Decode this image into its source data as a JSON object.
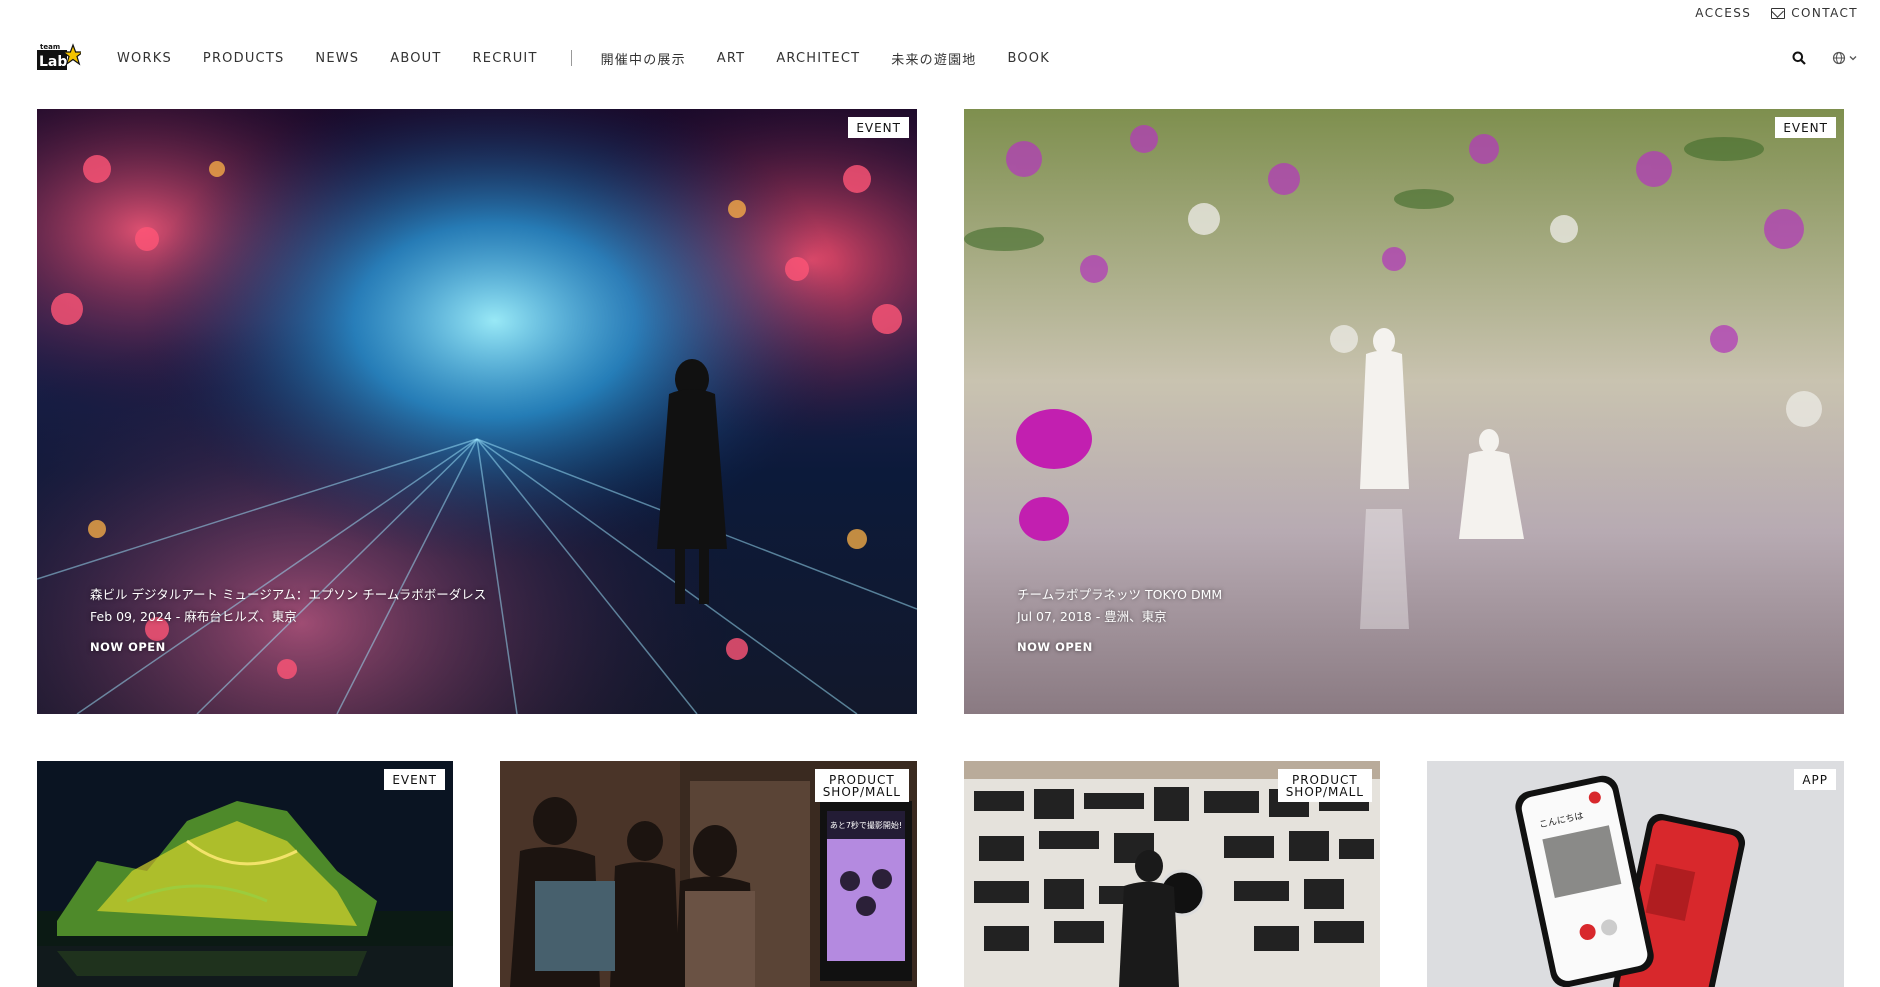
{
  "utility": {
    "access": "ACCESS",
    "contact": "CONTACT"
  },
  "logo": {
    "line1": "team",
    "line2": "Lab"
  },
  "nav": {
    "items": [
      "WORKS",
      "PRODUCTS",
      "NEWS",
      "ABOUT",
      "RECRUIT"
    ],
    "items2": [
      "開催中の展示",
      "ART",
      "ARCHITECT",
      "未来の遊園地",
      "BOOK"
    ]
  },
  "cards": [
    {
      "tag": "EVENT",
      "title": "森ビル デジタルアート ミュージアム：エプソン チームラボボーダレス",
      "date": "Feb 09, 2024 - 麻布台ヒルズ、東京",
      "status": "NOW OPEN"
    },
    {
      "tag": "EVENT",
      "title": "チームラボプラネッツ TOKYO DMM",
      "date": "Jul 07, 2018 - 豊洲、東京",
      "status": "NOW OPEN"
    },
    {
      "tag": "EVENT"
    },
    {
      "tag_line1": "PRODUCT",
      "tag_line2": "SHOP/MALL",
      "screen_text": "あと7秒で撮影開始!"
    },
    {
      "tag_line1": "PRODUCT",
      "tag_line2": "SHOP/MALL"
    },
    {
      "tag": "APP",
      "phone_text": "こんにちは"
    }
  ],
  "colors": {
    "accent_logo": "#f4c400",
    "text": "#333333",
    "background": "#ffffff"
  }
}
